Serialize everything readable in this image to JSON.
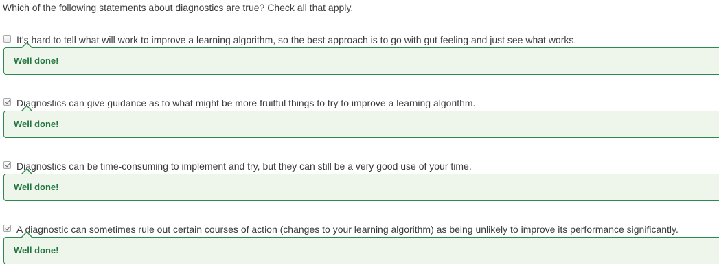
{
  "question": {
    "text": "Which of the following statements about diagnostics are true? Check all that apply."
  },
  "options": [
    {
      "checked": false,
      "label": "It’s hard to tell what will work to improve a learning algorithm, so the best approach is to go with gut feeling and just see what works.",
      "feedback": "Well done!"
    },
    {
      "checked": true,
      "label": "Diagnostics can give guidance as to what might be more fruitful things to try to improve a learning algorithm.",
      "feedback": "Well done!"
    },
    {
      "checked": true,
      "label": "Diagnostics can be time-consuming to implement and try, but they can still be a very good use of your time.",
      "feedback": "Well done!"
    },
    {
      "checked": true,
      "label": "A diagnostic can sometimes rule out certain courses of action (changes to your learning algorithm) as being unlikely to improve its performance significantly.",
      "feedback": "Well done!"
    }
  ],
  "colors": {
    "feedback_border": "#2b8a4f",
    "feedback_background": "#eef6ec",
    "feedback_text": "#22753f"
  }
}
